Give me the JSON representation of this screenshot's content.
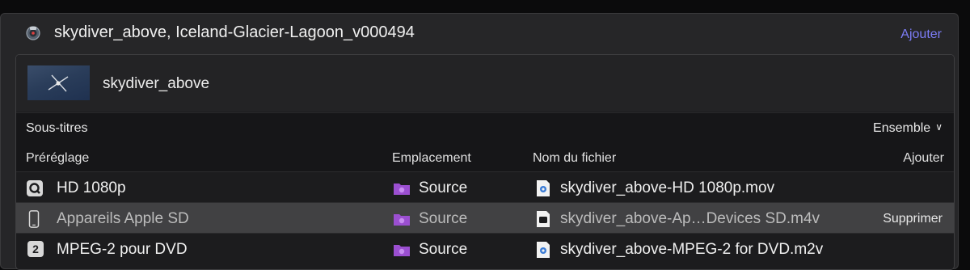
{
  "job": {
    "title": "skydiver_above, Iceland-Glacier-Lagoon_v000494",
    "add_label": "Ajouter"
  },
  "clip": {
    "name": "skydiver_above"
  },
  "subtitles": {
    "label": "Sous-titres",
    "mode": "Ensemble"
  },
  "columns": {
    "preset": "Préréglage",
    "location": "Emplacement",
    "filename": "Nom du fichier",
    "add_label": "Ajouter"
  },
  "rows": [
    {
      "preset": "HD 1080p",
      "preset_icon": "quicktime-icon",
      "location": "Source",
      "filename": "skydiver_above-HD 1080p.mov"
    },
    {
      "preset": "Appareils Apple SD",
      "preset_icon": "iphone-icon",
      "location": "Source",
      "filename": "skydiver_above-Ap…Devices SD.m4v",
      "action": "Supprimer",
      "selected": true
    },
    {
      "preset": "MPEG-2 pour DVD",
      "preset_icon": "mpeg2-icon",
      "preset_badge": "2",
      "location": "Source",
      "filename": "skydiver_above-MPEG-2 for DVD.m2v"
    }
  ],
  "colors": {
    "accent": "#7c7cf5",
    "folder": "#9b4fd1",
    "selected_row": "#414143"
  }
}
